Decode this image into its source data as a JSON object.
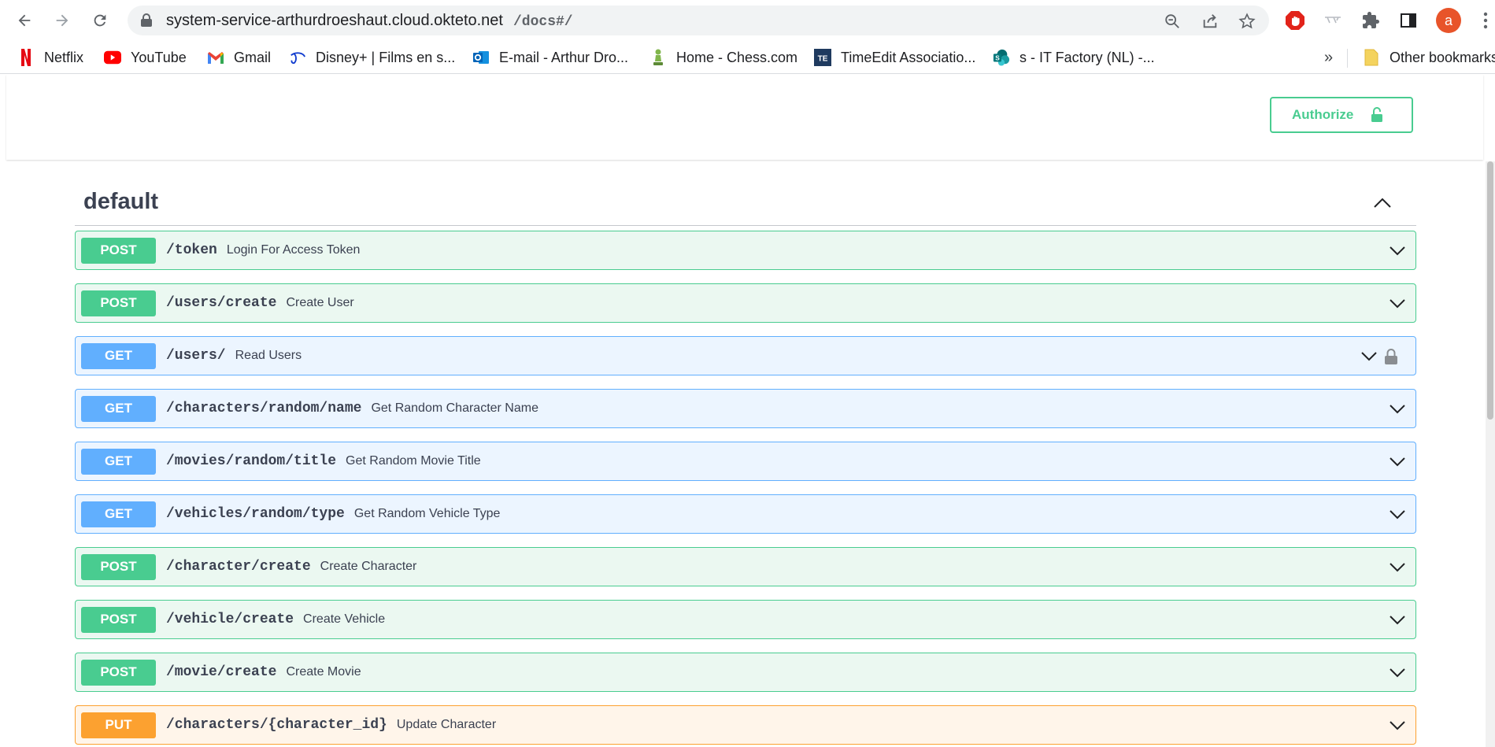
{
  "browser": {
    "url_host": "system-service-arthurdroeshaut.cloud.okteto.net",
    "url_path": "/docs#/",
    "avatar_letter": "a",
    "bookmarks": [
      {
        "label": "Netflix",
        "icon": "netflix-icon"
      },
      {
        "label": "YouTube",
        "icon": "youtube-icon"
      },
      {
        "label": "Gmail",
        "icon": "gmail-icon"
      },
      {
        "label": "Disney+ | Films en s...",
        "icon": "disney-icon"
      },
      {
        "label": "E-mail - Arthur Dro...",
        "icon": "outlook-icon"
      },
      {
        "label": "Home - Chess.com",
        "icon": "chess-icon"
      },
      {
        "label": "TimeEdit Associatio...",
        "icon": "timeedit-icon"
      },
      {
        "label": "s - IT Factory (NL) -...",
        "icon": "sharepoint-icon"
      }
    ],
    "bookmarks_overflow": "»",
    "other_bookmarks": "Other bookmarks"
  },
  "page": {
    "authorize_label": "Authorize",
    "section_title": "default",
    "operations": [
      {
        "method": "POST",
        "path": "/token",
        "summary": "Login For Access Token",
        "locked": false
      },
      {
        "method": "POST",
        "path": "/users/create",
        "summary": "Create User",
        "locked": false
      },
      {
        "method": "GET",
        "path": "/users/",
        "summary": "Read Users",
        "locked": true
      },
      {
        "method": "GET",
        "path": "/characters/random/name",
        "summary": "Get Random Character Name",
        "locked": false
      },
      {
        "method": "GET",
        "path": "/movies/random/title",
        "summary": "Get Random Movie Title",
        "locked": false
      },
      {
        "method": "GET",
        "path": "/vehicles/random/type",
        "summary": "Get Random Vehicle Type",
        "locked": false
      },
      {
        "method": "POST",
        "path": "/character/create",
        "summary": "Create Character",
        "locked": false
      },
      {
        "method": "POST",
        "path": "/vehicle/create",
        "summary": "Create Vehicle",
        "locked": false
      },
      {
        "method": "POST",
        "path": "/movie/create",
        "summary": "Create Movie",
        "locked": false
      },
      {
        "method": "PUT",
        "path": "/characters/{character_id}",
        "summary": "Update Character",
        "locked": false
      }
    ]
  },
  "colors": {
    "post": "#49cc90",
    "get": "#61affe",
    "put": "#fca130",
    "avatar": "#e8542a"
  }
}
